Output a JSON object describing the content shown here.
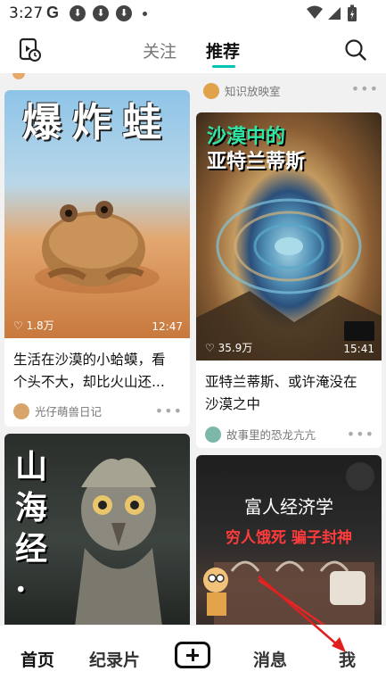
{
  "status_bar": {
    "time": "3:27",
    "g_label": "G"
  },
  "top_tabs": {
    "follow": "关注",
    "recommend": "推荐"
  },
  "cards": [
    {
      "title_art": "爆炸蛙",
      "likes": "1.8万",
      "duration": "12:47",
      "caption_line1": "生活在沙漠的小蛤蟆，看",
      "caption_line2": "个头不大，却比火山还...",
      "author": "光仔萌兽日记"
    },
    {
      "title_art_line1": "沙漠中的",
      "title_art_line2": "亚特兰蒂斯",
      "likes": "35.9万",
      "duration": "15:41",
      "caption_line1": "亚特兰蒂斯、或许淹没在",
      "caption_line2": "沙漠之中",
      "author": "故事里的恐龙亢亢",
      "top_author": "知识放映室"
    },
    {
      "title_art": "山海经·"
    },
    {
      "title_art_line1": "富人经济学",
      "title_art_line2": "穷人饿死 骗子封神"
    }
  ],
  "bottom_nav": {
    "home": "首页",
    "documentary": "纪录片",
    "messages": "消息",
    "me": "我"
  }
}
